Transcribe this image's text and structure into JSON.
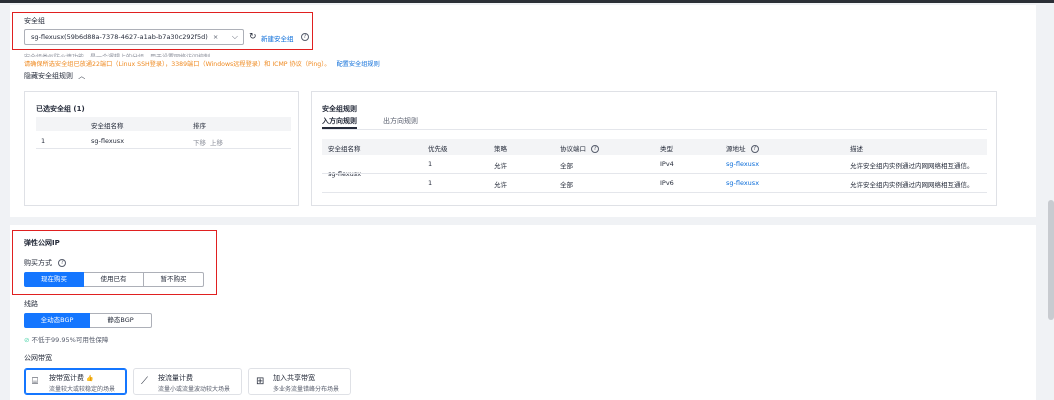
{
  "security_group": {
    "label": "安全组",
    "selected_tag": "sg-flexusx(59b6d88a-7378-4627-a1ab-b7a30c292f5d)",
    "tag_close": "×",
    "new_link": "新建安全组",
    "hint_line1": "安全组类似防火墙功能，是一个逻辑上的分组，用于设置网络访问控制。",
    "hint_line2": "请确保所选安全组已放通22端口（Linux SSH登录），3389端口（Windows远程登录）和 ICMP 协议（Ping）。",
    "hint_link": "配置安全组规则",
    "toggle_label": "隐藏安全组规则"
  },
  "selected_groups": {
    "title": "已选安全组 (1)",
    "columns": [
      "安全组名称",
      "排序"
    ],
    "rows": [
      {
        "index": "1",
        "name": "sg-flexusx",
        "down": "下移",
        "up": "上移"
      }
    ]
  },
  "rules": {
    "title": "安全组规则",
    "tabs": [
      "入方向规则",
      "出方向规则"
    ],
    "columns": [
      "安全组名称",
      "优先级",
      "策略",
      "协议端口",
      "类型",
      "源地址",
      "描述"
    ],
    "group_name": "sg-flexusx",
    "rows": [
      {
        "priority": "1",
        "policy": "允许",
        "port": "全部",
        "type": "IPv4",
        "source": "sg-flexusx",
        "desc": "允许安全组内实例通过内网网络相互通信。"
      },
      {
        "priority": "1",
        "policy": "允许",
        "port": "全部",
        "type": "IPv6",
        "source": "sg-flexusx",
        "desc": "允许安全组内实例通过内网网络相互通信。"
      }
    ]
  },
  "eip": {
    "title": "弹性公网IP",
    "purchase_label": "购买方式",
    "purchase_options": [
      "现在购买",
      "使用已有",
      "暂不购买"
    ],
    "line_label": "线路",
    "line_options": [
      "全动态BGP",
      "静态BGP"
    ],
    "sla": "不低于99.95%可用性保障",
    "bandwidth_label": "公网带宽",
    "bandwidth_options": [
      {
        "title": "按带宽计费",
        "sub": "流量较大或较稳定的场景",
        "badge": "👍"
      },
      {
        "title": "按流量计费",
        "sub": "流量小或流量波动较大场景"
      },
      {
        "title": "加入共享带宽",
        "sub": "多业务流量错峰分布场景"
      }
    ]
  },
  "colors": {
    "accent": "#1476ff",
    "warning": "#ef8a21",
    "highlight_box": "#e02020"
  }
}
